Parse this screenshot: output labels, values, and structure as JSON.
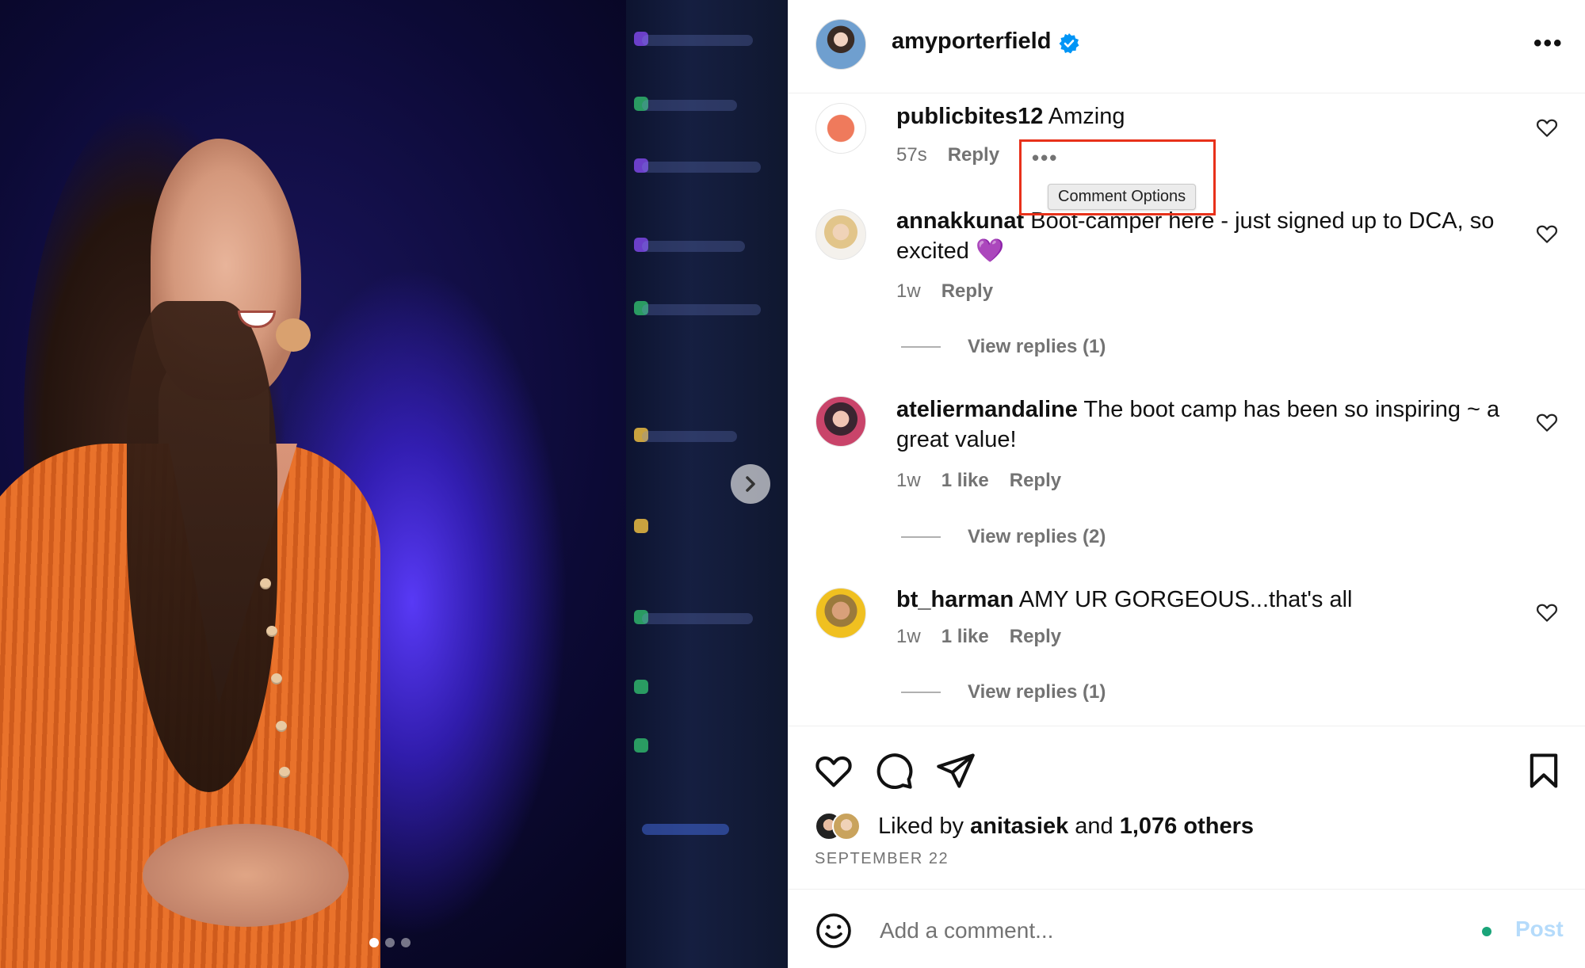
{
  "author": {
    "username": "amyporterfield",
    "verified_icon": "verified-badge-icon"
  },
  "comments": [
    {
      "username": "publicbites12",
      "text": "Amzing",
      "time": "57s",
      "likes": "",
      "reply_label": "Reply",
      "view_replies": ""
    },
    {
      "username": "annakkunat",
      "text": "Boot-camper here - just signed up to DCA, so excited 💜",
      "time": "1w",
      "likes": "",
      "reply_label": "Reply",
      "view_replies": "View replies (1)"
    },
    {
      "username": "ateliermandaline",
      "text": "The boot camp has been so inspiring ~ a great value!",
      "time": "1w",
      "likes": "1 like",
      "reply_label": "Reply",
      "view_replies": "View replies (2)"
    },
    {
      "username": "bt_harman",
      "text": "AMY UR GORGEOUS...that's all",
      "time": "1w",
      "likes": "1 like",
      "reply_label": "Reply",
      "view_replies": "View replies (1)"
    }
  ],
  "comment_options": {
    "tooltip": "Comment Options",
    "more_glyph": "•••"
  },
  "header_more_glyph": "•••",
  "likes": {
    "prefix": "Liked by",
    "first_liker": "anitasiek",
    "connector": "and",
    "others": "1,076 others"
  },
  "post_date": "SEPTEMBER 22",
  "comment_bar": {
    "placeholder": "Add a comment...",
    "post_label": "Post"
  },
  "carousel": {
    "total": 3,
    "active_index": 0
  },
  "colors": {
    "highlight_box": "#e8311a",
    "verified": "#0095f6",
    "muted_text": "#737373",
    "post_button": "#b5dbfb"
  }
}
